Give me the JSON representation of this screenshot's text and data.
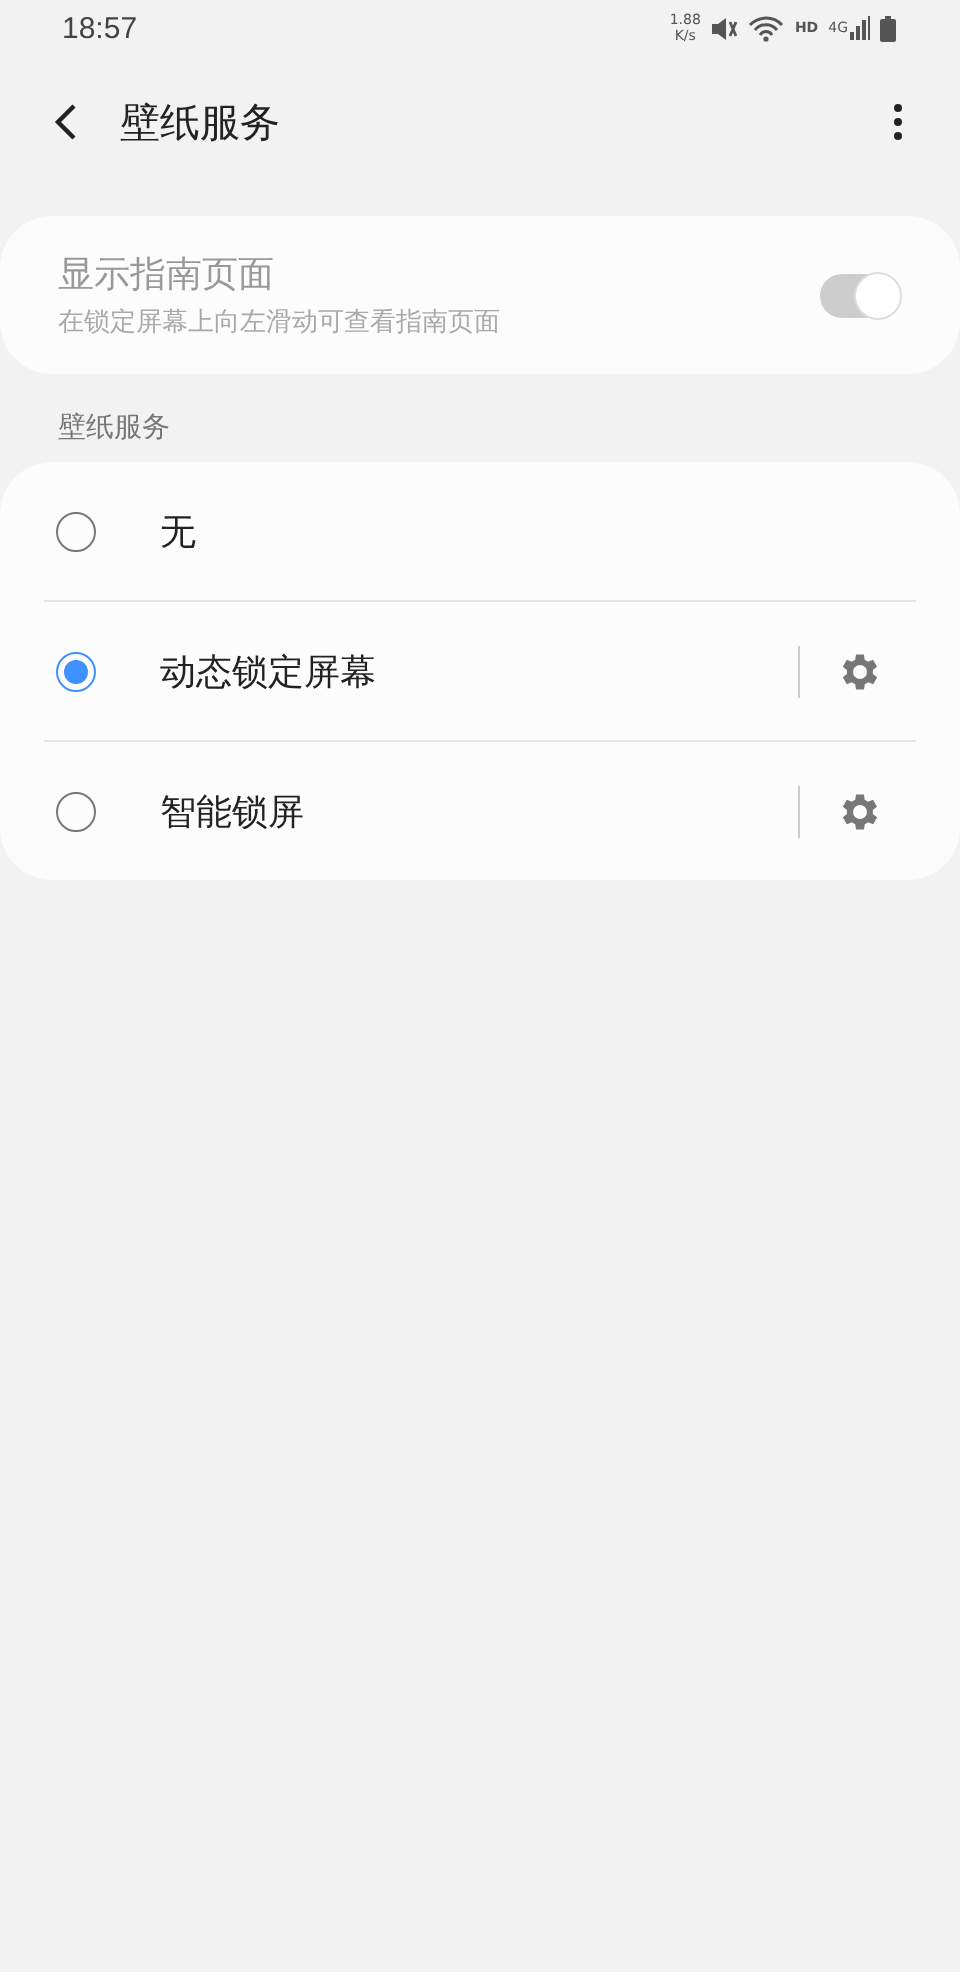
{
  "status_bar": {
    "time": "18:57",
    "speed_value": "1.88",
    "speed_unit": "K/s",
    "network_label": "HD",
    "network_type": "4G"
  },
  "header": {
    "title": "壁纸服务"
  },
  "guide": {
    "title": "显示指南页面",
    "subtitle": "在锁定屏幕上向左滑动可查看指南页面",
    "on": true,
    "disabled": true
  },
  "section": {
    "title": "壁纸服务"
  },
  "options": [
    {
      "label": "无",
      "selected": false,
      "kind": "plain"
    },
    {
      "label": "动态锁定屏幕",
      "selected": true,
      "kind": "settings"
    },
    {
      "label": "智能锁屏",
      "selected": false,
      "kind": "settings"
    }
  ]
}
